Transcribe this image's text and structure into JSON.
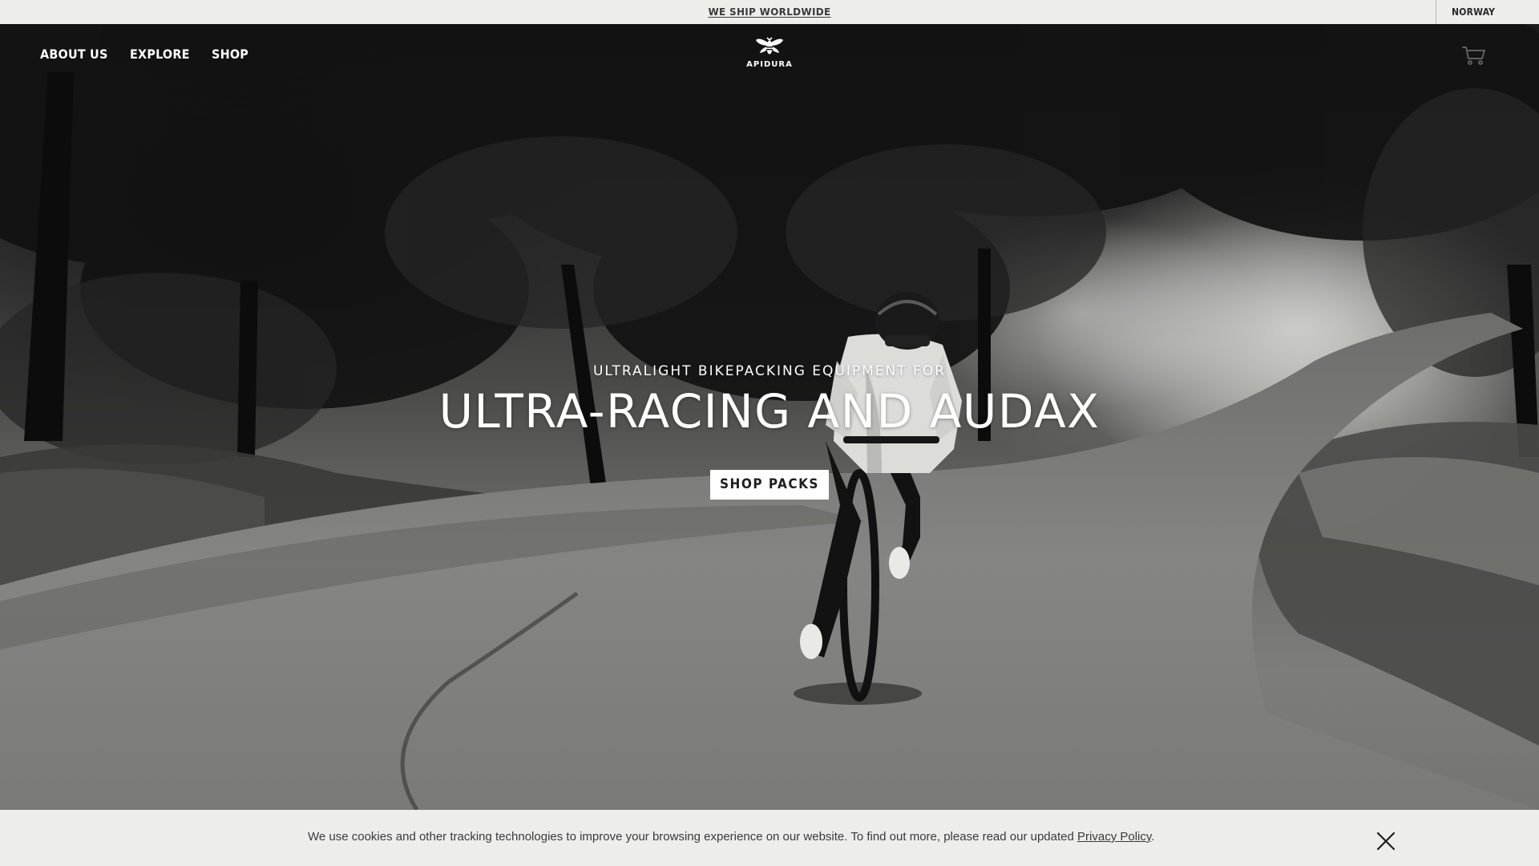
{
  "announcement": {
    "text": "WE SHIP WORLDWIDE",
    "region": "NORWAY"
  },
  "nav": {
    "about": "ABOUT US",
    "explore": "EXPLORE",
    "shop": "SHOP"
  },
  "brand": {
    "name": "APIDURA"
  },
  "hero": {
    "eyebrow": "ULTRALIGHT BIKEPACKING EQUIPMENT FOR",
    "title": "ULTRA-RACING AND AUDAX",
    "cta": "SHOP PACKS"
  },
  "cookie": {
    "text": "We use cookies and other tracking technologies to improve your browsing experience on our website. To find out more, please read our updated ",
    "link": "Privacy Policy",
    "suffix": "."
  },
  "icons": {
    "cart": "cart-icon",
    "close": "close-icon",
    "logo": "bee-logo-icon"
  },
  "colors": {
    "bar_background": "#ededea",
    "text_dark": "#3a3a3a",
    "hero_text": "#ffffff",
    "cta_background": "#ffffff"
  }
}
